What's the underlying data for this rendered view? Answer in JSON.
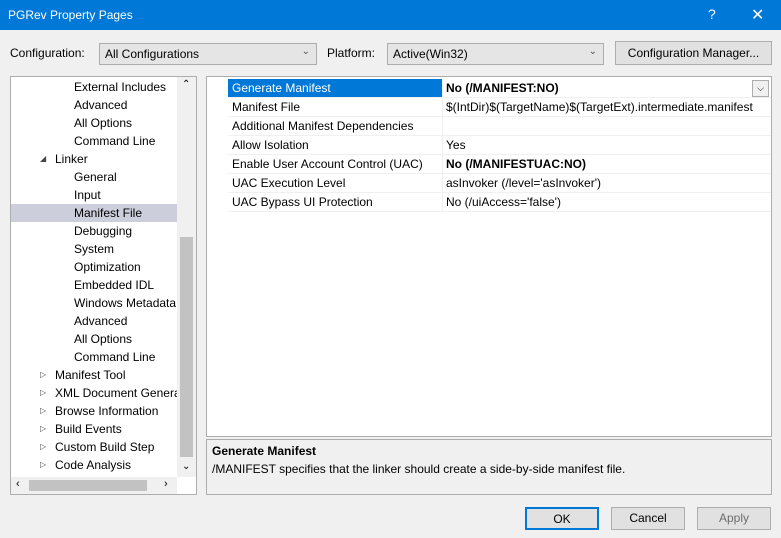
{
  "window": {
    "title": "PGRev Property Pages",
    "help": "?",
    "close": "✕"
  },
  "config": {
    "config_label": "Configuration:",
    "config_value": "All Configurations",
    "platform_label": "Platform:",
    "platform_value": "Active(Win32)",
    "manager_button": "Configuration Manager..."
  },
  "tree": {
    "items": [
      {
        "label": "External Includes",
        "level": 2
      },
      {
        "label": "Advanced",
        "level": 2
      },
      {
        "label": "All Options",
        "level": 2
      },
      {
        "label": "Command Line",
        "level": 2
      },
      {
        "label": "Linker",
        "level": 1,
        "expanded": true
      },
      {
        "label": "General",
        "level": 2
      },
      {
        "label": "Input",
        "level": 2
      },
      {
        "label": "Manifest File",
        "level": 2,
        "selected": true
      },
      {
        "label": "Debugging",
        "level": 2
      },
      {
        "label": "System",
        "level": 2
      },
      {
        "label": "Optimization",
        "level": 2
      },
      {
        "label": "Embedded IDL",
        "level": 2
      },
      {
        "label": "Windows Metadata",
        "level": 2
      },
      {
        "label": "Advanced",
        "level": 2
      },
      {
        "label": "All Options",
        "level": 2
      },
      {
        "label": "Command Line",
        "level": 2
      },
      {
        "label": "Manifest Tool",
        "level": 1,
        "expanded": false
      },
      {
        "label": "XML Document Generator",
        "level": 1,
        "expanded": false
      },
      {
        "label": "Browse Information",
        "level": 1,
        "expanded": false
      },
      {
        "label": "Build Events",
        "level": 1,
        "expanded": false
      },
      {
        "label": "Custom Build Step",
        "level": 1,
        "expanded": false
      },
      {
        "label": "Code Analysis",
        "level": 1,
        "expanded": false
      }
    ]
  },
  "grid": {
    "rows": [
      {
        "name": "Generate Manifest",
        "value": "No (/MANIFEST:NO)",
        "bold": true,
        "selected": true
      },
      {
        "name": "Manifest File",
        "value": "$(IntDir)$(TargetName)$(TargetExt).intermediate.manifest"
      },
      {
        "name": "Additional Manifest Dependencies",
        "value": ""
      },
      {
        "name": "Allow Isolation",
        "value": "Yes"
      },
      {
        "name": "Enable User Account Control (UAC)",
        "value": "No (/MANIFESTUAC:NO)",
        "bold": true
      },
      {
        "name": "UAC Execution Level",
        "value": "asInvoker (/level='asInvoker')"
      },
      {
        "name": "UAC Bypass UI Protection",
        "value": "No (/uiAccess='false')"
      }
    ]
  },
  "description": {
    "title": "Generate Manifest",
    "text": "/MANIFEST specifies that the linker should create a side-by-side manifest file."
  },
  "buttons": {
    "ok": "OK",
    "cancel": "Cancel",
    "apply": "Apply"
  },
  "colors": {
    "titlebar": "#0078d7",
    "selection": "#0078d7",
    "tree_selection": "#cccedb"
  }
}
